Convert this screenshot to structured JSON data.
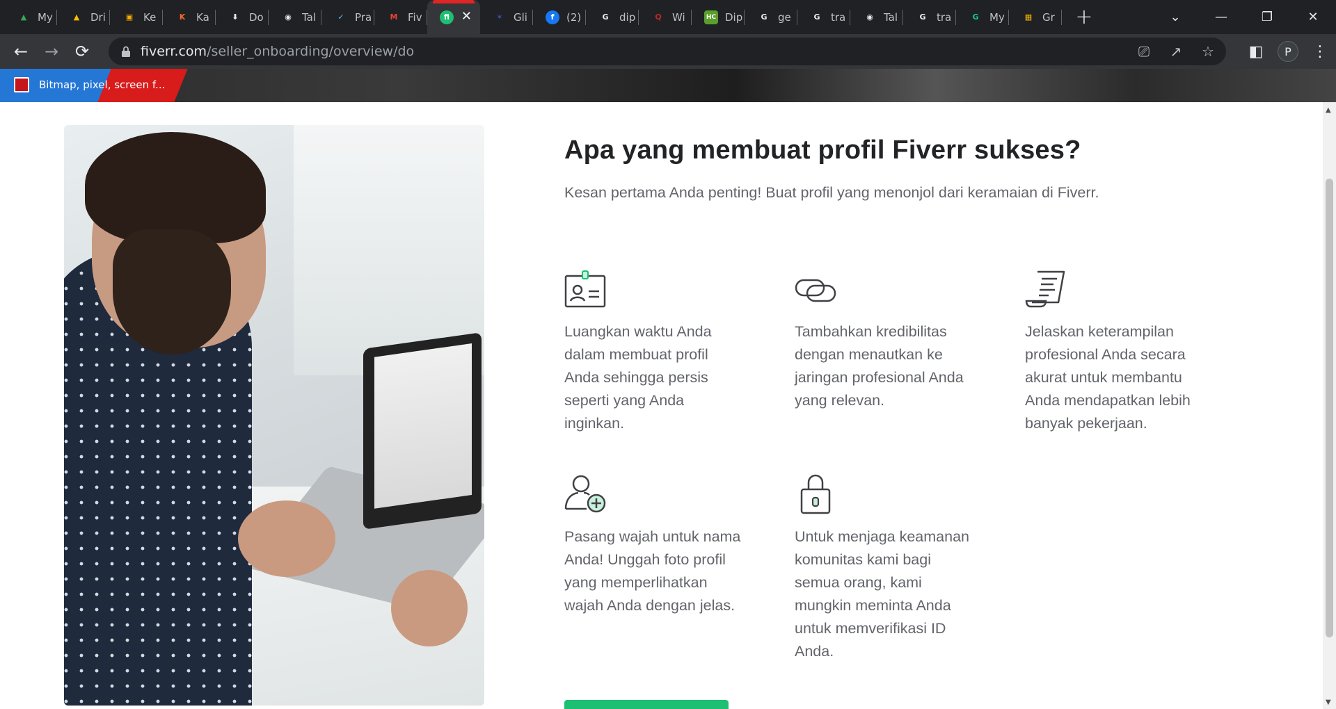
{
  "browser": {
    "tabs": [
      {
        "label": "My",
        "icon": "google-drive-icon",
        "color": "#34a853"
      },
      {
        "label": "Dri",
        "icon": "google-drive-icon",
        "color": "#fbbc04"
      },
      {
        "label": "Ke",
        "icon": "google-classroom-icon",
        "color": "#f9ab00"
      },
      {
        "label": "Ka",
        "icon": "kahoot-icon",
        "color": "#f26a25"
      },
      {
        "label": "Do",
        "icon": "download-icon",
        "color": "#e8eaed"
      },
      {
        "label": "Tal",
        "icon": "chrome-icon",
        "color": "#e8eaed"
      },
      {
        "label": "Pra",
        "icon": "bird-icon",
        "color": "#4fc3f7"
      },
      {
        "label": "Fiv",
        "icon": "gmail-icon",
        "color": "#ea4335"
      },
      {
        "label": "",
        "icon": "fiverr-icon",
        "color": "#1dbf73",
        "active": true
      },
      {
        "label": "Gli",
        "icon": "star-icon",
        "color": "#3f51b5"
      },
      {
        "label": "(2)",
        "icon": "facebook-icon",
        "color": "#1877f2"
      },
      {
        "label": "dip",
        "icon": "google-icon",
        "color": "#e8eaed"
      },
      {
        "label": "Wi",
        "icon": "quora-icon",
        "color": "#b92b27"
      },
      {
        "label": "Dip",
        "icon": "hc-icon",
        "color": "#5a9e2e"
      },
      {
        "label": "ge",
        "icon": "google-icon",
        "color": "#e8eaed"
      },
      {
        "label": "tra",
        "icon": "google-icon",
        "color": "#e8eaed"
      },
      {
        "label": "Tal",
        "icon": "chrome-icon",
        "color": "#e8eaed"
      },
      {
        "label": "tra",
        "icon": "google-icon",
        "color": "#e8eaed"
      },
      {
        "label": "My",
        "icon": "grammarly-icon",
        "color": "#15c39a"
      },
      {
        "label": "Gr",
        "icon": "classroom-icon",
        "color": "#f4b400"
      }
    ],
    "url_host": "fiverr.com",
    "url_path": "/seller_onboarding/overview/do",
    "profile_initial": "P",
    "bookmark_label": "Bitmap, pixel, screen f..."
  },
  "main": {
    "title": "Apa yang membuat profil Fiverr sukses?",
    "subtitle": "Kesan pertama Anda penting! Buat profil yang menonjol dari keramaian di Fiverr.",
    "features": [
      {
        "icon": "id-card-icon",
        "text": "Luangkan waktu Anda dalam membuat profil Anda sehingga persis seperti yang Anda inginkan."
      },
      {
        "icon": "link-icon",
        "text": "Tambahkan kredibilitas dengan menautkan ke jaringan profesional Anda yang relevan."
      },
      {
        "icon": "scroll-icon",
        "text": "Jelaskan keterampilan profesional Anda secara akurat untuk membantu Anda mendapatkan lebih banyak pekerjaan."
      },
      {
        "icon": "add-user-icon",
        "text": "Pasang wajah untuk nama Anda! Unggah foto profil yang memperlihatkan wajah Anda dengan jelas."
      },
      {
        "icon": "padlock-icon",
        "text": "Untuk menjaga keamanan komunitas kami bagi semua orang, kami mungkin meminta Anda untuk memverifikasi ID Anda."
      }
    ],
    "accent_color": "#1dbf73"
  }
}
